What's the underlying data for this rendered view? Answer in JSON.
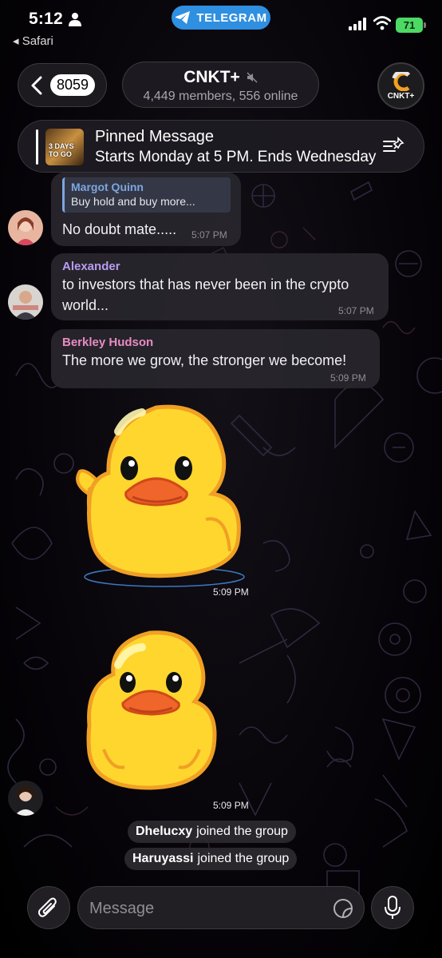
{
  "status_bar": {
    "time": "5:12",
    "back_app": "Safari",
    "notification": "TELEGRAM",
    "battery": "71"
  },
  "header": {
    "back_count": "8059",
    "title": "CNKT+",
    "subtitle": "4,449 members, 556 online",
    "channel_avatar_label": "CNKT+"
  },
  "pinned": {
    "title": "Pinned Message",
    "text": "Starts Monday at 5 PM. Ends Wednesday",
    "thumb_text": "3 DAYS TO GO"
  },
  "messages": [
    {
      "reply_name": "Margot Quinn",
      "reply_text": "Buy hold and buy more...",
      "text": "No doubt mate.....",
      "time": "5:07 PM"
    },
    {
      "sender": "Alexander",
      "sender_color": "#b99cf2",
      "text_line1": "to investors that has never been in the crypto",
      "text_line2": "world...",
      "time": "5:07 PM"
    },
    {
      "sender": "Berkley Hudson",
      "sender_color": "#e98bc4",
      "text": "The more we grow, the stronger we become!",
      "time": "5:09 PM"
    }
  ],
  "stickers": [
    {
      "icon": "waving-duck-sticker",
      "time": "5:09 PM"
    },
    {
      "icon": "duck-sticker",
      "time": "5:09 PM"
    }
  ],
  "service_messages": [
    {
      "name": "Dhelucxy",
      "text": "joined the group"
    },
    {
      "name": "Haruyassi",
      "text": "joined the group"
    }
  ],
  "input": {
    "placeholder": "Message"
  },
  "colors": {
    "accent": "#2f8fe0",
    "battery": "#4cd964",
    "reply_accent": "#7ea6e0",
    "duck_yellow": "#ffd62e",
    "duck_beak": "#f0662a"
  }
}
